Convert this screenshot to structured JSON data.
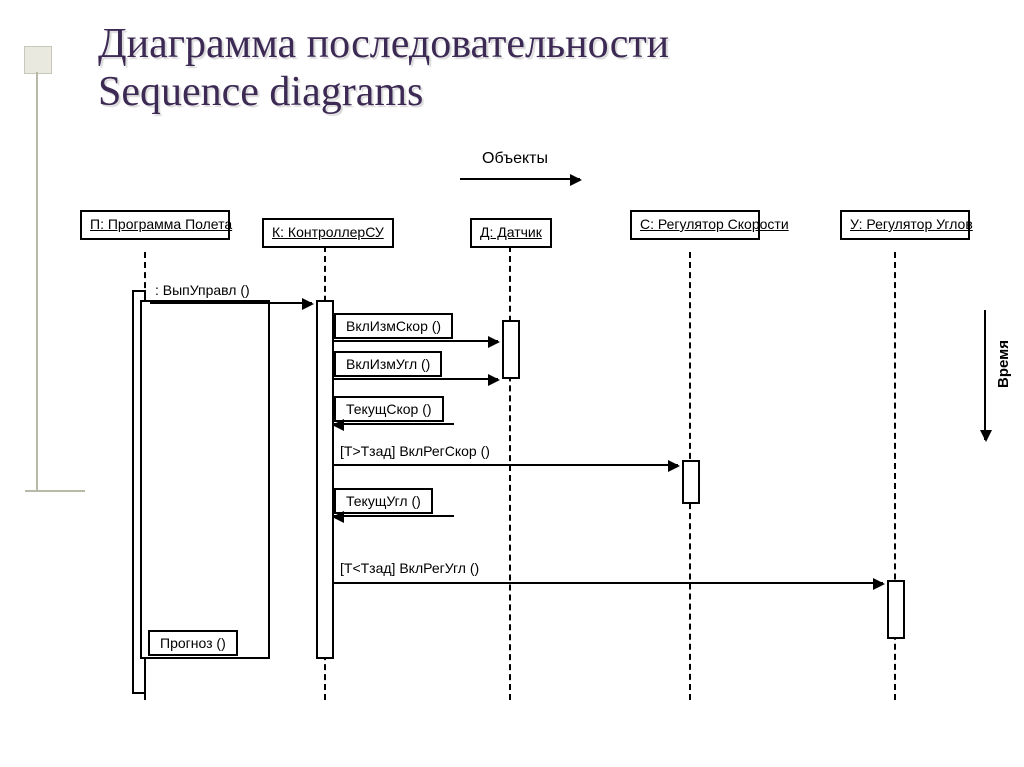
{
  "title_line1": "Диаграмма последовательности",
  "title_line2": "Sequence diagrams",
  "objects_label": "Объекты",
  "time_label": "Время",
  "participants": {
    "p": "П: Программа Полета",
    "k": "К: КонтроллерСУ",
    "d": "Д: Датчик",
    "s": "С: Регулятор Скорости",
    "u": "У: Регулятор Углов"
  },
  "messages": {
    "m1": ": ВыпУправл ()",
    "m2": "ВклИзмСкор ()",
    "m3": "ВклИзмУгл ()",
    "m4": "ТекущСкор ()",
    "m5": "[Т>Тзад] ВклРегСкор ()",
    "m6": "ТекущУгл ()",
    "m7": "[Т<Тзад] ВклРегУгл ()",
    "m8": "Прогноз ()"
  }
}
